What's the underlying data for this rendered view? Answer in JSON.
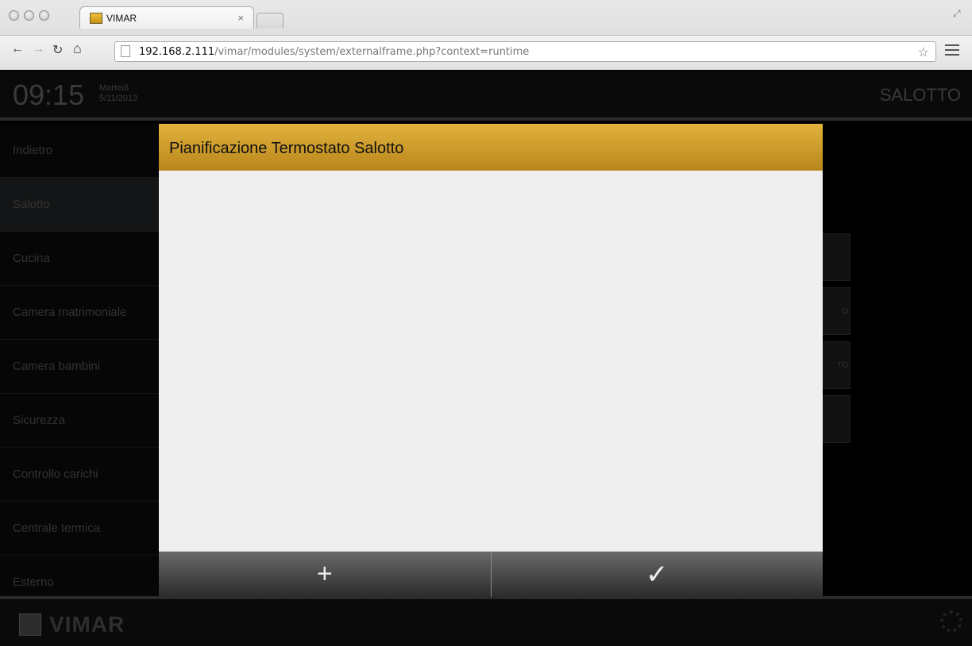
{
  "browser": {
    "tab_title": "VIMAR",
    "tab_close": "×",
    "url_host": "192.168.2.111",
    "url_path": "/vimar/modules/system/externalframe.php?context=runtime",
    "icons": [
      "back-icon",
      "forward-icon",
      "reload-icon",
      "home-icon",
      "page-icon",
      "star-icon",
      "menu-icon"
    ]
  },
  "header": {
    "time": "09:15",
    "weekday": "Martedì",
    "date": "5/11/2013",
    "room": "SALOTTO"
  },
  "sidebar": {
    "items": [
      {
        "label": "Indietro"
      },
      {
        "label": "Salotto"
      },
      {
        "label": "Cucina"
      },
      {
        "label": "Camera matrimoniale"
      },
      {
        "label": "Camera bambini"
      },
      {
        "label": "Sicurezza"
      },
      {
        "label": "Controllo carichi"
      },
      {
        "label": "Centrale termica"
      },
      {
        "label": "Esterno"
      }
    ]
  },
  "right_panel": {
    "items": [
      {
        "label": ""
      },
      {
        "label": "O"
      },
      {
        "label": "TO"
      },
      {
        "label": ""
      }
    ]
  },
  "modal": {
    "title": "Pianificazione Termostato Salotto",
    "add_glyph": "+",
    "confirm_glyph": "✓"
  },
  "footer": {
    "brand": "VIMAR"
  },
  "colors": {
    "modal_header": "#d4a12c",
    "modal_body": "#efefef",
    "background": "#000000"
  }
}
